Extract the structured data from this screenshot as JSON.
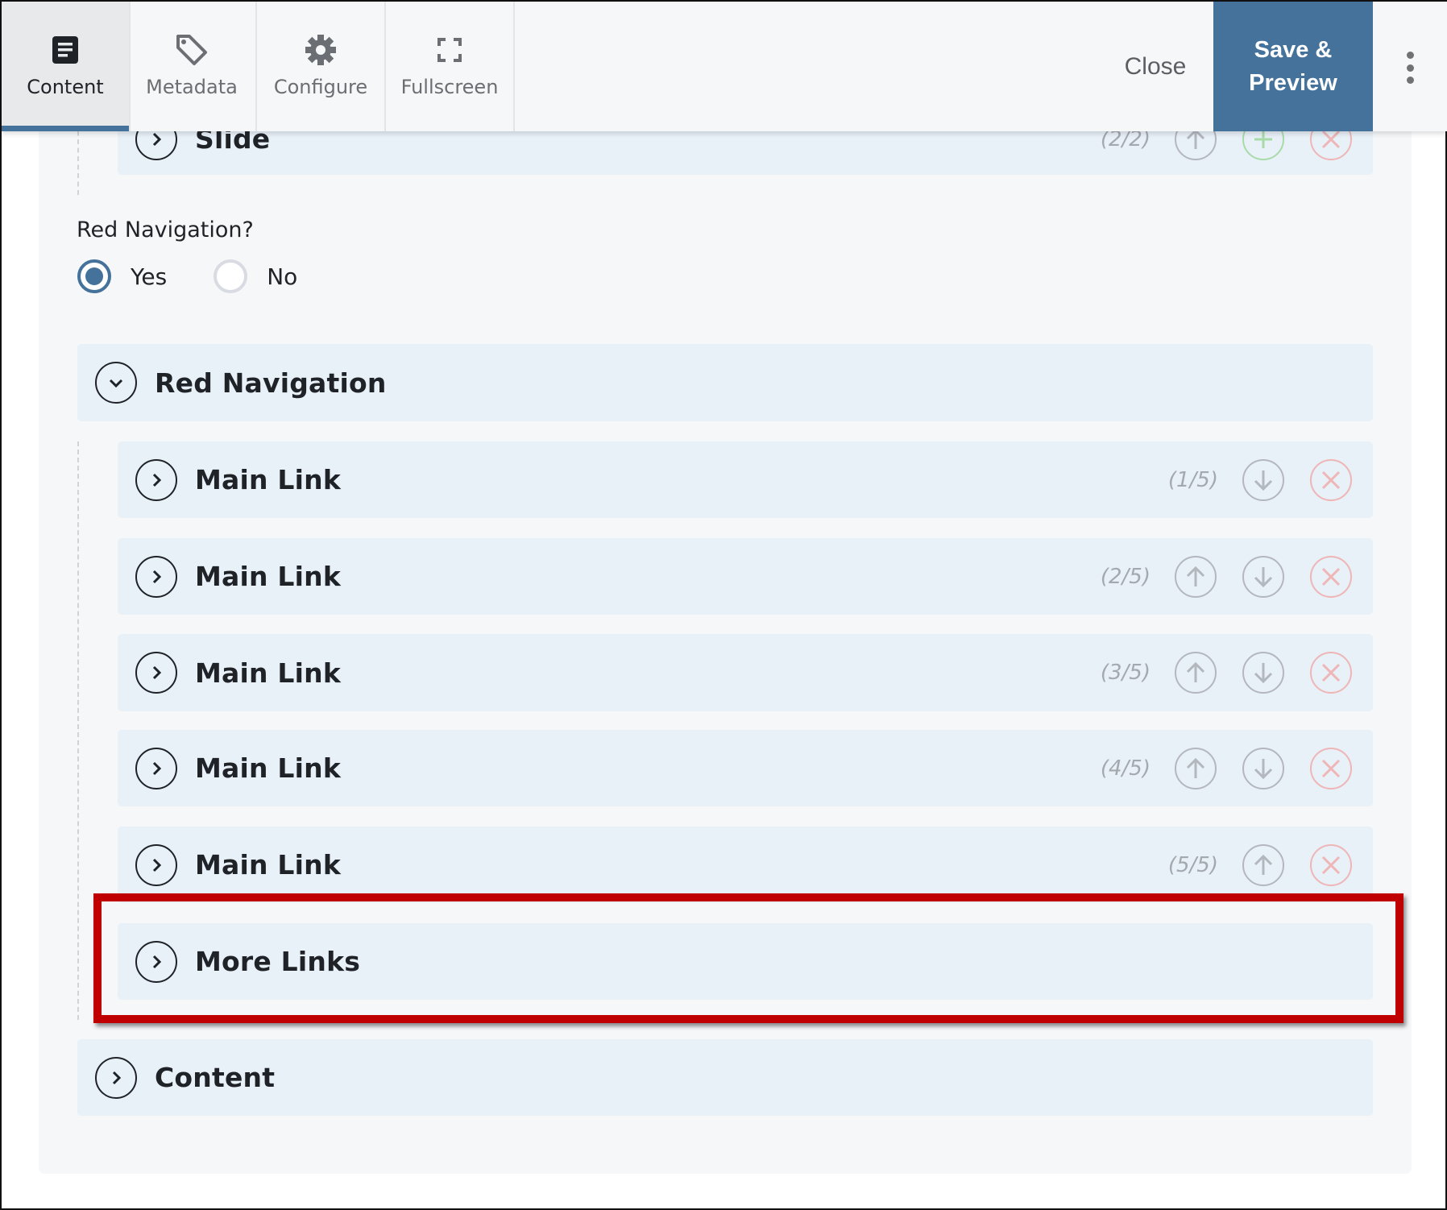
{
  "toolbar": {
    "tabs": [
      {
        "label": "Content",
        "icon": "document-icon",
        "active": true
      },
      {
        "label": "Metadata",
        "icon": "tag-icon",
        "active": false
      },
      {
        "label": "Configure",
        "icon": "gear-icon",
        "active": false
      },
      {
        "label": "Fullscreen",
        "icon": "fullscreen-icon",
        "active": false
      }
    ],
    "close_label": "Close",
    "save_label": "Save & Preview",
    "more_icon": "kebab-menu-icon"
  },
  "slide_row": {
    "title": "Slide",
    "counter": "(2/2)"
  },
  "red_navigation_field": {
    "label": "Red Navigation?",
    "options": [
      {
        "label": "Yes",
        "checked": true
      },
      {
        "label": "No",
        "checked": false
      }
    ]
  },
  "red_navigation_section": {
    "title": "Red Navigation",
    "expanded": true,
    "items": [
      {
        "title": "Main Link",
        "counter": "(1/5)"
      },
      {
        "title": "Main Link",
        "counter": "(2/5)"
      },
      {
        "title": "Main Link",
        "counter": "(3/5)"
      },
      {
        "title": "Main Link",
        "counter": "(4/5)"
      },
      {
        "title": "Main Link",
        "counter": "(5/5)"
      }
    ],
    "more_links": {
      "title": "More Links"
    }
  },
  "content_section": {
    "title": "Content"
  },
  "colors": {
    "accent": "#44729b",
    "row_bg": "#e8f0f8",
    "panel_bg": "#f6f7f9",
    "delete": "#eeb6b6",
    "add": "#a8dba8",
    "highlight": "#c00000"
  }
}
